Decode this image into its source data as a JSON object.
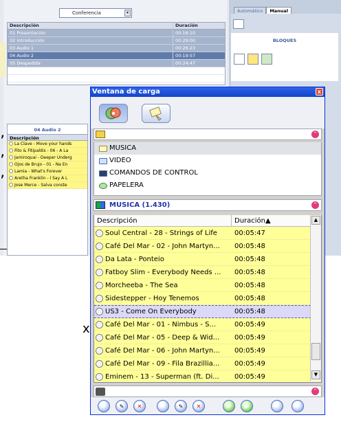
{
  "background": {
    "channel_select": "Conferencia",
    "playlist": {
      "headers": [
        "Descripción",
        "Duración"
      ],
      "rows": [
        {
          "desc": "01 Presentación",
          "dur": "00:16:10"
        },
        {
          "desc": "02 Introducción",
          "dur": "00:29:00"
        },
        {
          "desc": "03 Audio 1",
          "dur": "00:26:23"
        },
        {
          "desc": "04 Audio 2",
          "dur": "00:19:57"
        },
        {
          "desc": "05 Despedida",
          "dur": "00:24:47"
        }
      ]
    },
    "sub_panel": {
      "title": "04 Audio 2",
      "header": "Descripción",
      "rows": [
        "La Clave - Move your hands",
        "Fito & Fitipaldis - 06 - A La",
        "Jamiroquai - Deeper Underg",
        "Ojos de Brujo - 01 - Na En",
        "Lamia - What's Forever",
        "Aretha Franklin - I Say A L",
        "Jose Merce - Salva conste"
      ]
    },
    "tabs": [
      "Automático",
      "Manual"
    ],
    "blocks_title": "BLOQUES",
    "stray": {
      "c1": "’",
      "c2": "’",
      "c3": "’",
      "x": "x"
    }
  },
  "window": {
    "title": "Ventana de carga",
    "close": "x",
    "folders": [
      {
        "label": "MUSICA",
        "icon": "folder-open-icon"
      },
      {
        "label": "VIDEO",
        "icon": "folder-icon"
      },
      {
        "label": "COMANDOS DE CONTROL",
        "icon": "terminal-icon"
      },
      {
        "label": "PAPELERA",
        "icon": "recycle-bin-icon"
      }
    ],
    "list_title": "MUSICA (1.430)",
    "columns": [
      "Descripción",
      "Duración▲"
    ],
    "rows": [
      {
        "desc": "Soul Central - 28 - Strings of Life",
        "dur": "00:05:47"
      },
      {
        "desc": "Café Del Mar - 02 - John Martyn...",
        "dur": "00:05:48"
      },
      {
        "desc": "Da Lata - Ponteio",
        "dur": "00:05:48"
      },
      {
        "desc": "Fatboy Slim - Everybody Needs ...",
        "dur": "00:05:48"
      },
      {
        "desc": "Morcheeba - The Sea",
        "dur": "00:05:48"
      },
      {
        "desc": "Sidestepper - Hoy Tenemos",
        "dur": "00:05:48"
      },
      {
        "desc": "US3 - Come On Everybody",
        "dur": "00:05:48",
        "selected": true
      },
      {
        "desc": "Café Del Mar - 01 - Nimbus - S...",
        "dur": "00:05:49"
      },
      {
        "desc": "Café Del Mar - 05 - Deep & Wid...",
        "dur": "00:05:49"
      },
      {
        "desc": "Café Del Mar - 06 - John Martyn...",
        "dur": "00:05:49"
      },
      {
        "desc": "Café Del Mar - 09 - Fila Brazillia...",
        "dur": "00:05:49"
      },
      {
        "desc": "Eminem - 13 - Superman (ft. Di...",
        "dur": "00:05:49"
      }
    ],
    "colors": {
      "title_bar": "#2d63e8",
      "list_bg": "#ffff99",
      "section_label": "#2335a8"
    }
  }
}
